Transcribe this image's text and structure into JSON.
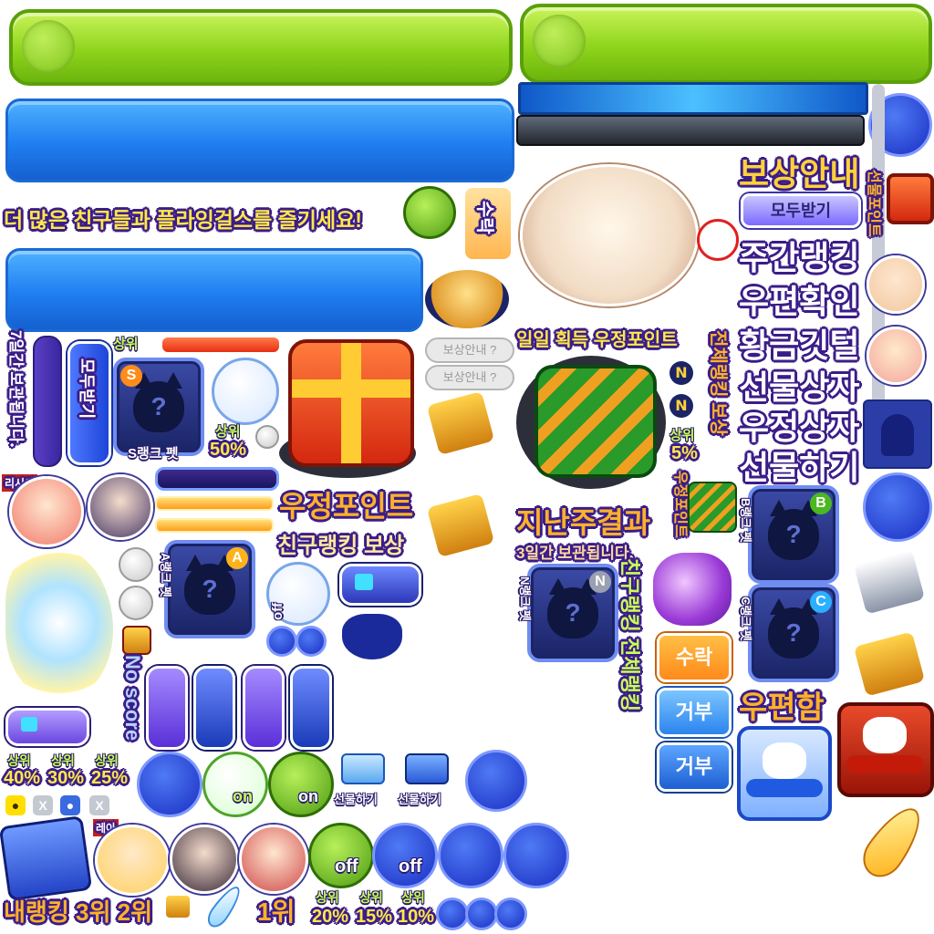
{
  "texts": {
    "enjoy": "더 많은 친구들과 플라잉걸스를 즐기세요!",
    "accept_vertical": "수락",
    "reward_info": "보상안내",
    "receive_all": "모두받기",
    "weekly_ranking": "주간랭킹",
    "check_mail": "우편확인",
    "gold_feather": "황금깃털",
    "gift_box": "선물상자",
    "friendship_box": "우정상자",
    "send_gift": "선물하기",
    "gift_point": "선물포인트",
    "daily_fp": "일일 획득 우정포인트",
    "total_rank_reward": "전체랭킹 보상",
    "friendship_point": "우정포인트",
    "friend_rank_reward": "친구랭킹 보상",
    "last_week": "지난주결과",
    "kept_3days": "3일간 보관됩니다.",
    "kept_7days": "7일간 보관됩니다.",
    "friend_rank": "친구랭킹",
    "total_rank": "전체랭킹",
    "accept": "수락",
    "reject": "거부",
    "mailbox": "우편함",
    "my_rank": "내랭킹",
    "third": "3위",
    "second": "2위",
    "first": "1위",
    "top": "상위",
    "no_score": "No score",
    "on": "on",
    "off": "off",
    "s_pet": "S랭크 펫",
    "a_pet": "A랭크 펫",
    "b_pet": "B랭크 펫",
    "c_pet": "C랭크 펫",
    "n_pet": "N랭크 펫",
    "reward_info_small": "보상안내",
    "letter_n": "N",
    "rank_s": "S",
    "rank_a": "A",
    "rank_b": "B",
    "rank_c": "C",
    "rank_n": "N",
    "question": "?",
    "lisa": "리시아",
    "rea": "레아",
    "x": "X"
  },
  "percents": {
    "p50": "50%",
    "p5": "5%",
    "p40": "40%",
    "p30": "30%",
    "p25": "25%",
    "p20": "20%",
    "p15": "15%",
    "p10": "10%"
  },
  "colors": {
    "outline": "#3b1d88",
    "accent_green": "#8ed41b",
    "accent_blue": "#1f7ef0",
    "gold": "#ffcc33"
  }
}
